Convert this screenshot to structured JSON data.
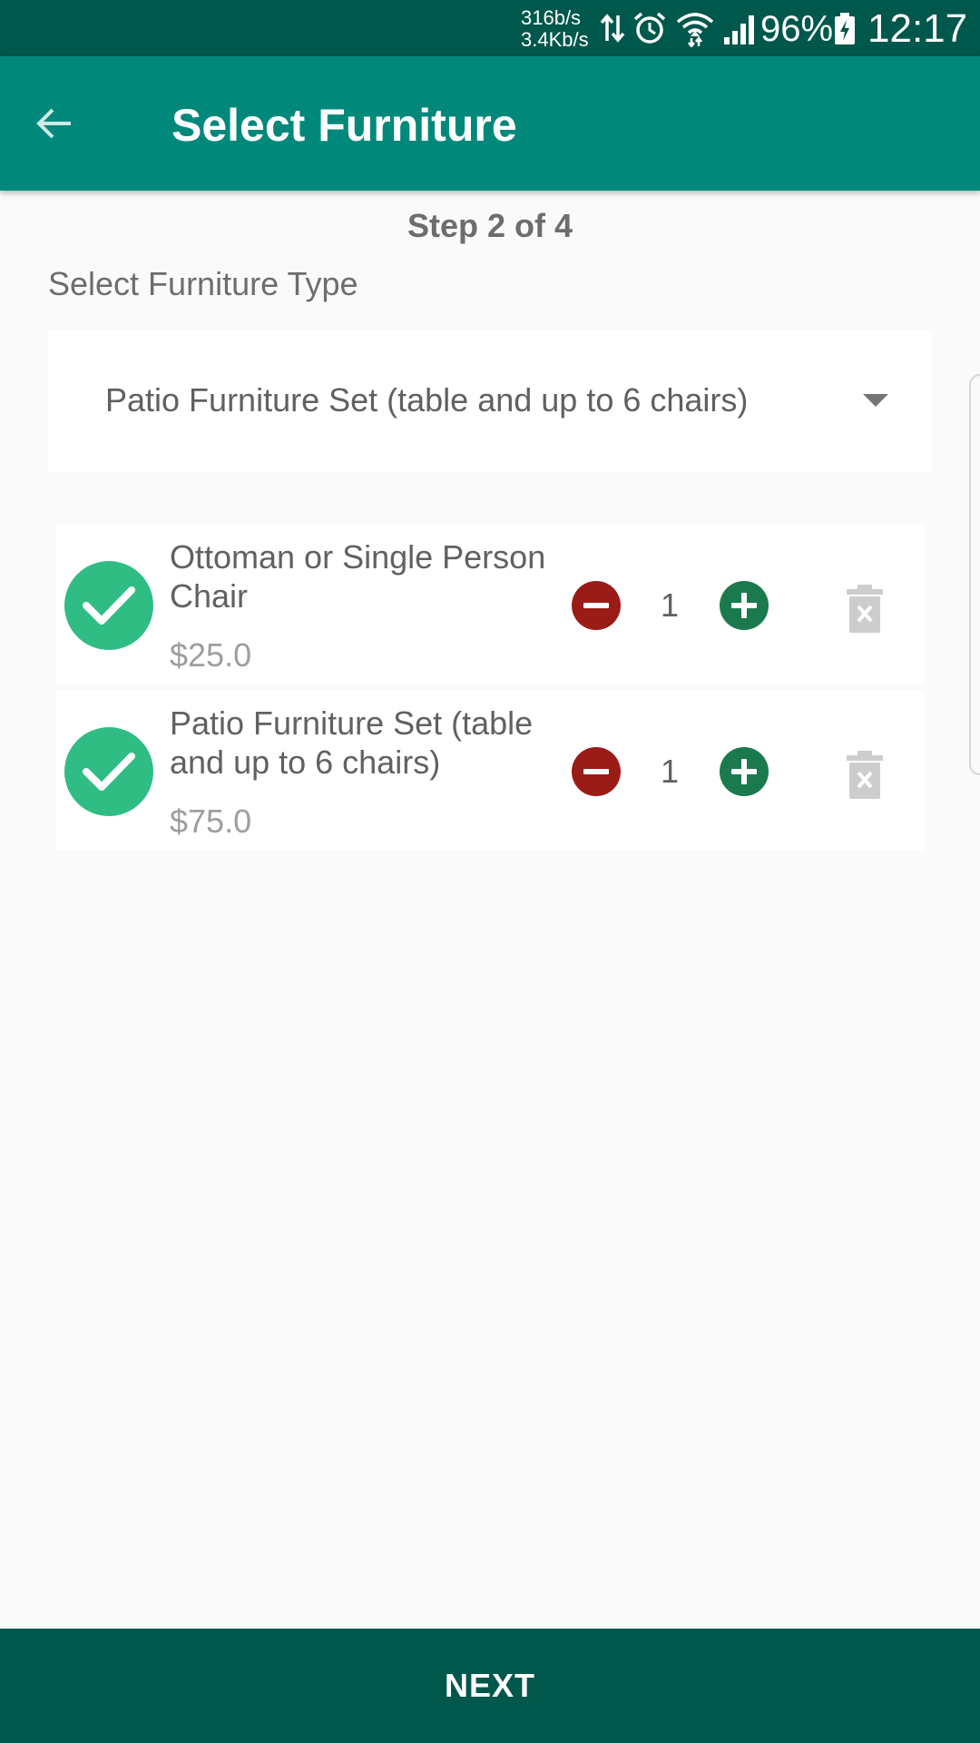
{
  "status_bar": {
    "upload_speed": "316b/s",
    "download_speed": "3.4Kb/s",
    "battery_percent": "96%",
    "time": "12:17",
    "icons": [
      "data-transfer-icon",
      "alarm-icon",
      "wifi-icon",
      "cell-signal-icon",
      "battery-charging-icon"
    ]
  },
  "app_bar": {
    "title": "Select Furniture",
    "back_icon": "arrow-back-icon",
    "color": "#00897b"
  },
  "step": "Step 2 of 4",
  "furniture_type": {
    "label": "Select Furniture Type",
    "selected": "Patio Furniture Set (table and up to 6 chairs)"
  },
  "items": [
    {
      "name": "Ottoman or Single Person Chair",
      "price": "$25.0",
      "quantity": "1",
      "selected": true
    },
    {
      "name": "Patio Furniture Set (table and up to 6 chairs)",
      "price": "$75.0",
      "quantity": "1",
      "selected": true
    }
  ],
  "colors": {
    "check": "#2fbd84",
    "minus": "#9b1b17",
    "plus": "#1a7a4e",
    "dark_green": "#00574b"
  },
  "footer": {
    "next_label": "NEXT"
  }
}
